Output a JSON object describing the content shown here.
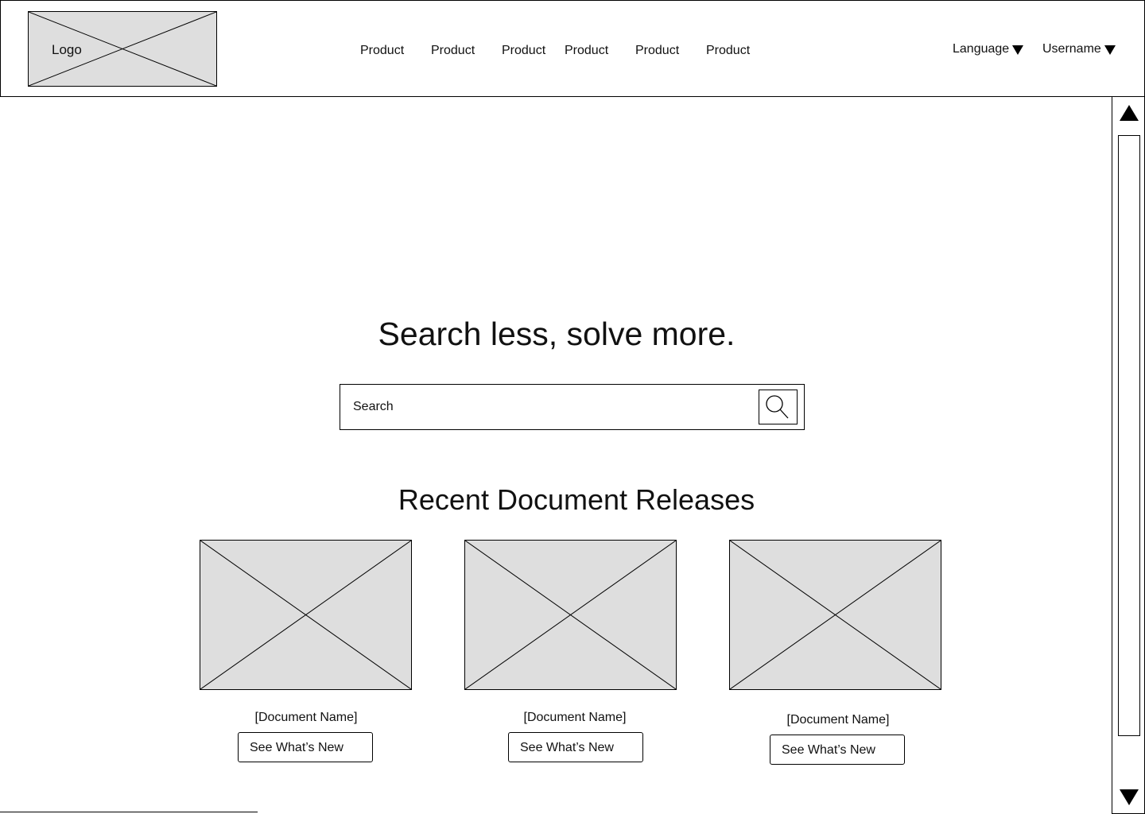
{
  "header": {
    "logo_label": "Logo",
    "nav": [
      {
        "label": "Product"
      },
      {
        "label": "Product"
      },
      {
        "label": "Product"
      },
      {
        "label": "Product"
      },
      {
        "label": "Product"
      },
      {
        "label": "Product"
      }
    ],
    "language_label": "Language",
    "username_label": "Username"
  },
  "hero": {
    "title": "Search less, solve more.",
    "search_placeholder": "Search"
  },
  "recent": {
    "title": "Recent Document Releases",
    "cards": [
      {
        "name": "[Document Name]",
        "button_label": "See What’s New"
      },
      {
        "name": "[Document Name]",
        "button_label": "See What’s New"
      },
      {
        "name": "[Document Name]",
        "button_label": "See What’s New"
      }
    ]
  },
  "colors": {
    "placeholder_fill": "#dedede",
    "border": "#000000",
    "background": "#ffffff"
  },
  "icons": [
    "search-icon",
    "chevron-down-icon",
    "scroll-up-icon",
    "scroll-down-icon",
    "image-placeholder-icon"
  ]
}
